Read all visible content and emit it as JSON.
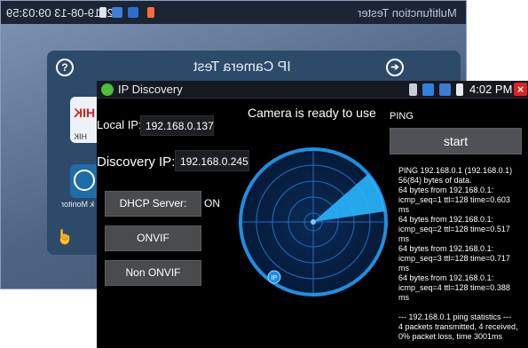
{
  "background_app": {
    "status_time": "2019-08-13 09:03:59",
    "app_title": "Multifunction Tester",
    "screen_title": "IP Camera Test",
    "help_icon": "?",
    "tiles": [
      {
        "logo": "HIK",
        "label": "HIK"
      },
      {
        "label": "k Monitor"
      }
    ]
  },
  "window": {
    "title": "IP Discovery",
    "time": "4:02 PM",
    "close_label": "×"
  },
  "left": {
    "local_ip_label": "Local IP:",
    "local_ip_value": "192.168.0.137",
    "discovery_ip_label": "Discovery IP:",
    "discovery_ip_value": "192.168.0.245",
    "dhcp_button": "DHCP Server:",
    "dhcp_value": "ON",
    "onvif_button": "ONVIF",
    "non_onvif_button": "Non ONVIF"
  },
  "center": {
    "status": "Camera is ready to use",
    "radar_marker": "IP"
  },
  "right": {
    "ping_title": "PING",
    "start_button": "start",
    "output_lines": [
      "PING 192.168.0.1 (192.168.0.1) 56(84) bytes of data.",
      "64 bytes from 192.168.0.1: icmp_seq=1 ttl=128 time=0.603 ms",
      "64 bytes from 192.168.0.1: icmp_seq=2 ttl=128 time=0.517 ms",
      "64 bytes from 192.168.0.1: icmp_seq=3 ttl=128 time=0.717 ms",
      "64 bytes from 192.168.0.1: icmp_seq=4 ttl=128 time=0.388 ms",
      "",
      "--- 192.168.0.1 ping statistics ---",
      "4 packets transmitted, 4 received, 0% packet loss, time 3001ms"
    ]
  },
  "colors": {
    "radar_blue": "#1f8fe0",
    "radar_sweep": "#29b6ff",
    "close_red": "#e02121",
    "app_icon_green": "#4dbd3a"
  },
  "icons": [
    "sd-card-icon",
    "usb-icon",
    "signal-icon",
    "battery-icon",
    "app-logo-icon"
  ]
}
